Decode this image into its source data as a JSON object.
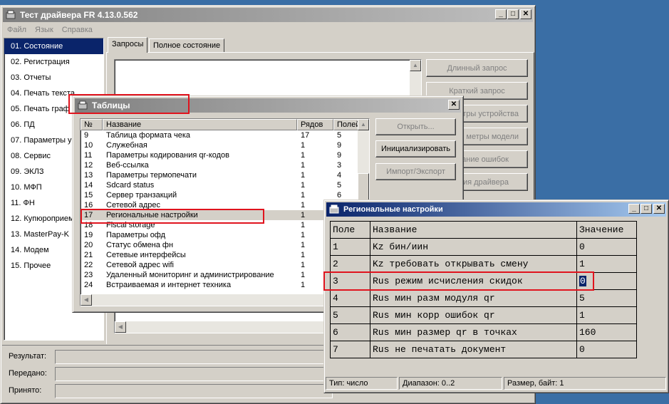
{
  "main_window": {
    "title": "Тест драйвера FR 4.13.0.562",
    "menu": [
      "Файл",
      "Язык",
      "Справка"
    ],
    "nav": [
      "01. Состояние",
      "02. Регистрация",
      "03. Отчеты",
      "04. Печать текста",
      "05. Печать граф",
      "06. ПД",
      "07. Параметры у",
      "08. Сервис",
      "09. ЭКЛЗ",
      "10. МФП",
      "11. ФН",
      "12. Купюроприем",
      "13. MasterPay-K",
      "14. Модем",
      "15. Прочее"
    ],
    "tabs": [
      "Запросы",
      "Полное состояние"
    ],
    "right_buttons": [
      "Длинный запрос",
      "Краткий запрос",
      "метры устройства",
      "метры модели",
      "вание ошибок",
      "ия драйвера"
    ],
    "bottom_labels": [
      "Результат:",
      "Передано:",
      "Принято:"
    ]
  },
  "tables_window": {
    "title": "Таблицы",
    "columns": [
      "№",
      "Название",
      "Рядов",
      "Полей"
    ],
    "rows": [
      [
        "9",
        "Таблица формата чека",
        "17",
        "5"
      ],
      [
        "10",
        "Служебная",
        "1",
        "9"
      ],
      [
        "11",
        "Параметры кодирования qr-кодов",
        "1",
        "9"
      ],
      [
        "12",
        "Веб-ссылка",
        "1",
        "3"
      ],
      [
        "13",
        "Параметры термопечати",
        "1",
        "4"
      ],
      [
        "14",
        "Sdcard status",
        "1",
        "5"
      ],
      [
        "15",
        "Сервер транзакций",
        "1",
        "6"
      ],
      [
        "16",
        "Сетевой адрес",
        "1",
        ""
      ],
      [
        "17",
        "Региональные настройки",
        "1",
        ""
      ],
      [
        "18",
        "Fiscal storage",
        "1",
        ""
      ],
      [
        "19",
        "Параметры офд",
        "1",
        ""
      ],
      [
        "20",
        "Статус обмена фн",
        "1",
        ""
      ],
      [
        "21",
        "Сетевые интерфейсы",
        "1",
        ""
      ],
      [
        "22",
        "Сетевой адрес wifi",
        "1",
        ""
      ],
      [
        "23",
        "Удаленный мониторинг и администрирование",
        "1",
        ""
      ],
      [
        "24",
        "Встраиваемая и интернет техника",
        "1",
        ""
      ]
    ],
    "buttons": [
      "Открыть...",
      "Инициализировать",
      "Импорт/Экспорт"
    ]
  },
  "regional_window": {
    "title": "Региональные настройки",
    "columns": [
      "Поле",
      "Название",
      "Значение"
    ],
    "rows": [
      [
        "1",
        "Kz бин/иин",
        "0"
      ],
      [
        "2",
        "Kz требовать открывать смену",
        "1"
      ],
      [
        "3",
        "Rus режим исчисления скидок",
        "0"
      ],
      [
        "4",
        "Rus мин разм модуля qr",
        "5"
      ],
      [
        "5",
        "Rus мин корр ошибок qr",
        "1"
      ],
      [
        "6",
        "Rus мин размер qr в точках",
        "160"
      ],
      [
        "7",
        "Rus не печатать документ",
        "0"
      ]
    ],
    "status": [
      "Тип: число",
      "Диапазон: 0..2",
      "Размер, байт: 1"
    ]
  },
  "colors": {
    "desktop": "#3a6ea5",
    "selection": "#0a246a",
    "highlight": "#e0141e",
    "face": "#d4d0c8"
  }
}
